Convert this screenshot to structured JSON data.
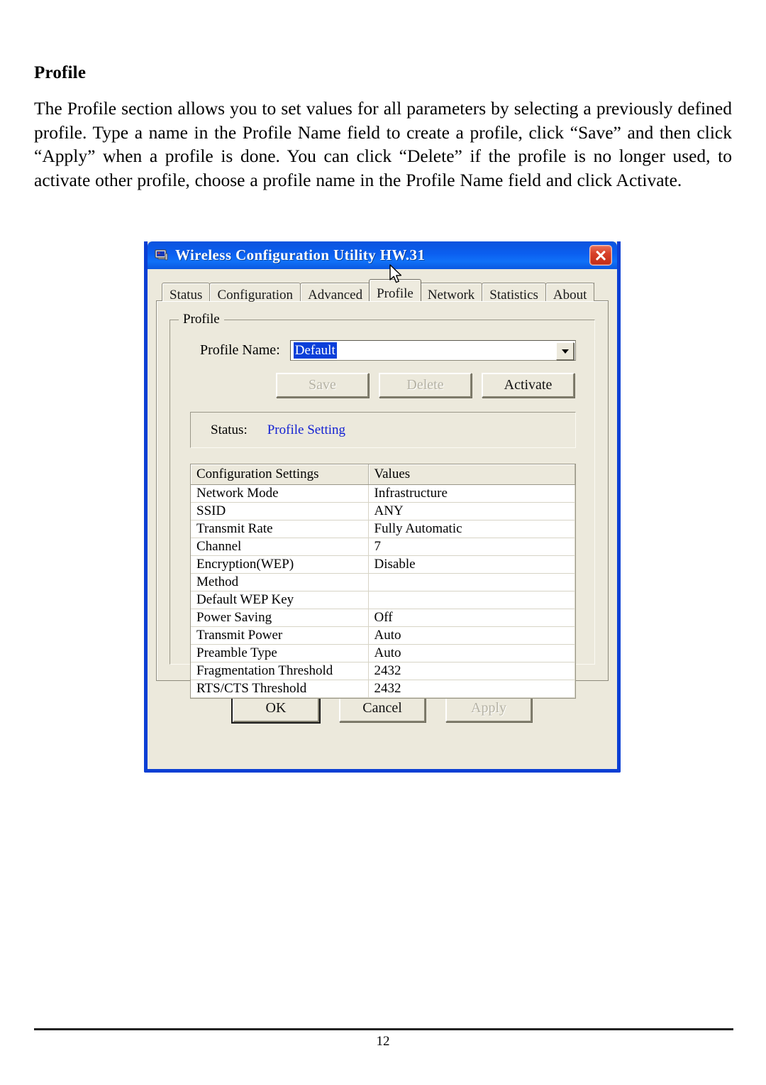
{
  "document": {
    "heading": "Profile",
    "paragraph": "The Profile section allows you to set values for all parameters by selecting a previously defined profile. Type a name in the Profile Name field to create a profile, click “Save” and then click “Apply” when a profile is done. You can click “Delete” if the profile is no longer used, to activate other profile, choose a profile name in the Profile Name field and click Activate.",
    "page_number": "12"
  },
  "dialog": {
    "title": "Wireless Configuration Utility HW.31",
    "title_icon": "computer-icon",
    "close_icon": "close-icon",
    "colors": {
      "titlebar_blue": "#0b5ff0",
      "frame_blue": "#0a3fd4",
      "face": "#ece9dc",
      "close_red": "#d8412a",
      "selection_blue": "#0b3fd9",
      "status_link_blue": "#1422d2",
      "corner_accent_red": "#e2241a"
    },
    "tabs": [
      {
        "label": "Status",
        "active": false
      },
      {
        "label": "Configuration",
        "active": false
      },
      {
        "label": "Advanced",
        "active": false
      },
      {
        "label": "Profile",
        "active": true
      },
      {
        "label": "Network",
        "active": false
      },
      {
        "label": "Statistics",
        "active": false
      },
      {
        "label": "About",
        "active": false
      }
    ],
    "groupbox": {
      "title": "Profile",
      "profile_name_label": "Profile Name:",
      "profile_name_value": "Default",
      "profile_name_placeholder": "Default",
      "dropdown_icon": "chevron-down-icon",
      "buttons": [
        {
          "label": "Save",
          "enabled": false
        },
        {
          "label": "Delete",
          "enabled": false
        },
        {
          "label": "Activate",
          "enabled": true
        }
      ],
      "status_label": "Status:",
      "status_value": "Profile Setting",
      "table": {
        "headers": [
          "Configuration Settings",
          "Values"
        ],
        "rows": [
          {
            "name": "Network Mode",
            "value": "Infrastructure"
          },
          {
            "name": "SSID",
            "value": "ANY"
          },
          {
            "name": "Transmit Rate",
            "value": "Fully Automatic"
          },
          {
            "name": "Channel",
            "value": "7"
          },
          {
            "name": "Encryption(WEP)",
            "value": "Disable"
          },
          {
            "name": "Method",
            "value": ""
          },
          {
            "name": "Default WEP Key",
            "value": ""
          },
          {
            "name": "Power Saving",
            "value": "Off"
          },
          {
            "name": "Transmit Power",
            "value": "Auto"
          },
          {
            "name": "Preamble Type",
            "value": "Auto"
          },
          {
            "name": "Fragmentation Threshold",
            "value": "2432"
          },
          {
            "name": "RTS/CTS Threshold",
            "value": "2432"
          }
        ]
      }
    },
    "footer_buttons": [
      {
        "label": "OK",
        "enabled": true,
        "default": true
      },
      {
        "label": "Cancel",
        "enabled": true,
        "default": false
      },
      {
        "label": "Apply",
        "enabled": false,
        "default": false
      }
    ]
  }
}
